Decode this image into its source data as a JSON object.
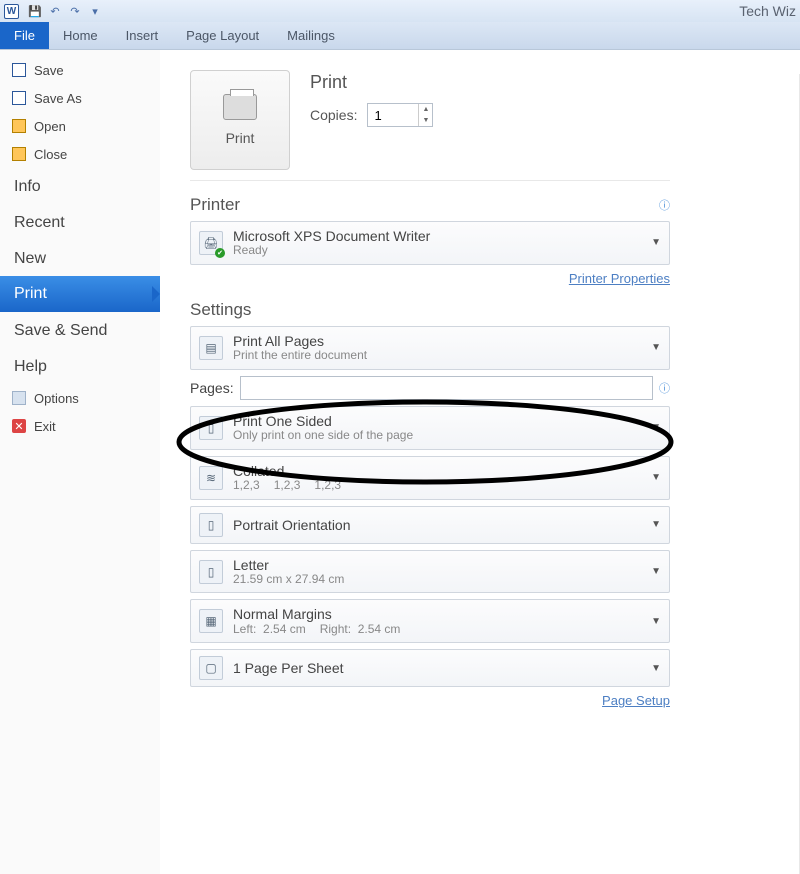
{
  "titlebar": {
    "app": "W",
    "doc_title": "Tech Wiz"
  },
  "ribbon": {
    "tabs": [
      "File",
      "Home",
      "Insert",
      "Page Layout",
      "Mailings"
    ],
    "active_index": 0
  },
  "backstage": {
    "quick": [
      {
        "label": "Save",
        "icon": "save"
      },
      {
        "label": "Save As",
        "icon": "saveas"
      },
      {
        "label": "Open",
        "icon": "open"
      },
      {
        "label": "Close",
        "icon": "close"
      }
    ],
    "sections": [
      "Info",
      "Recent",
      "New",
      "Print",
      "Save & Send",
      "Help"
    ],
    "selected_section": "Print",
    "footer": [
      {
        "label": "Options",
        "icon": "opt"
      },
      {
        "label": "Exit",
        "icon": "exit"
      }
    ]
  },
  "print": {
    "big_button": "Print",
    "heading_print": "Print",
    "copies_label": "Copies:",
    "copies_value": "1",
    "printer_heading": "Printer",
    "printer_name": "Microsoft XPS Document Writer",
    "printer_status": "Ready",
    "printer_properties": "Printer Properties",
    "settings_heading": "Settings",
    "pages_label": "Pages:",
    "pages_value": "",
    "page_setup": "Page Setup",
    "settings": [
      {
        "main": "Print All Pages",
        "sub": "Print the entire document"
      },
      {
        "main": "Print One Sided",
        "sub": "Only print on one side of the page"
      },
      {
        "main": "Collated",
        "sub": "1,2,3    1,2,3    1,2,3"
      },
      {
        "main": "Portrait Orientation",
        "sub": ""
      },
      {
        "main": "Letter",
        "sub": "21.59 cm x 27.94 cm"
      },
      {
        "main": "Normal Margins",
        "sub": "Left:  2.54 cm    Right:  2.54 cm"
      },
      {
        "main": "1 Page Per Sheet",
        "sub": ""
      }
    ]
  }
}
